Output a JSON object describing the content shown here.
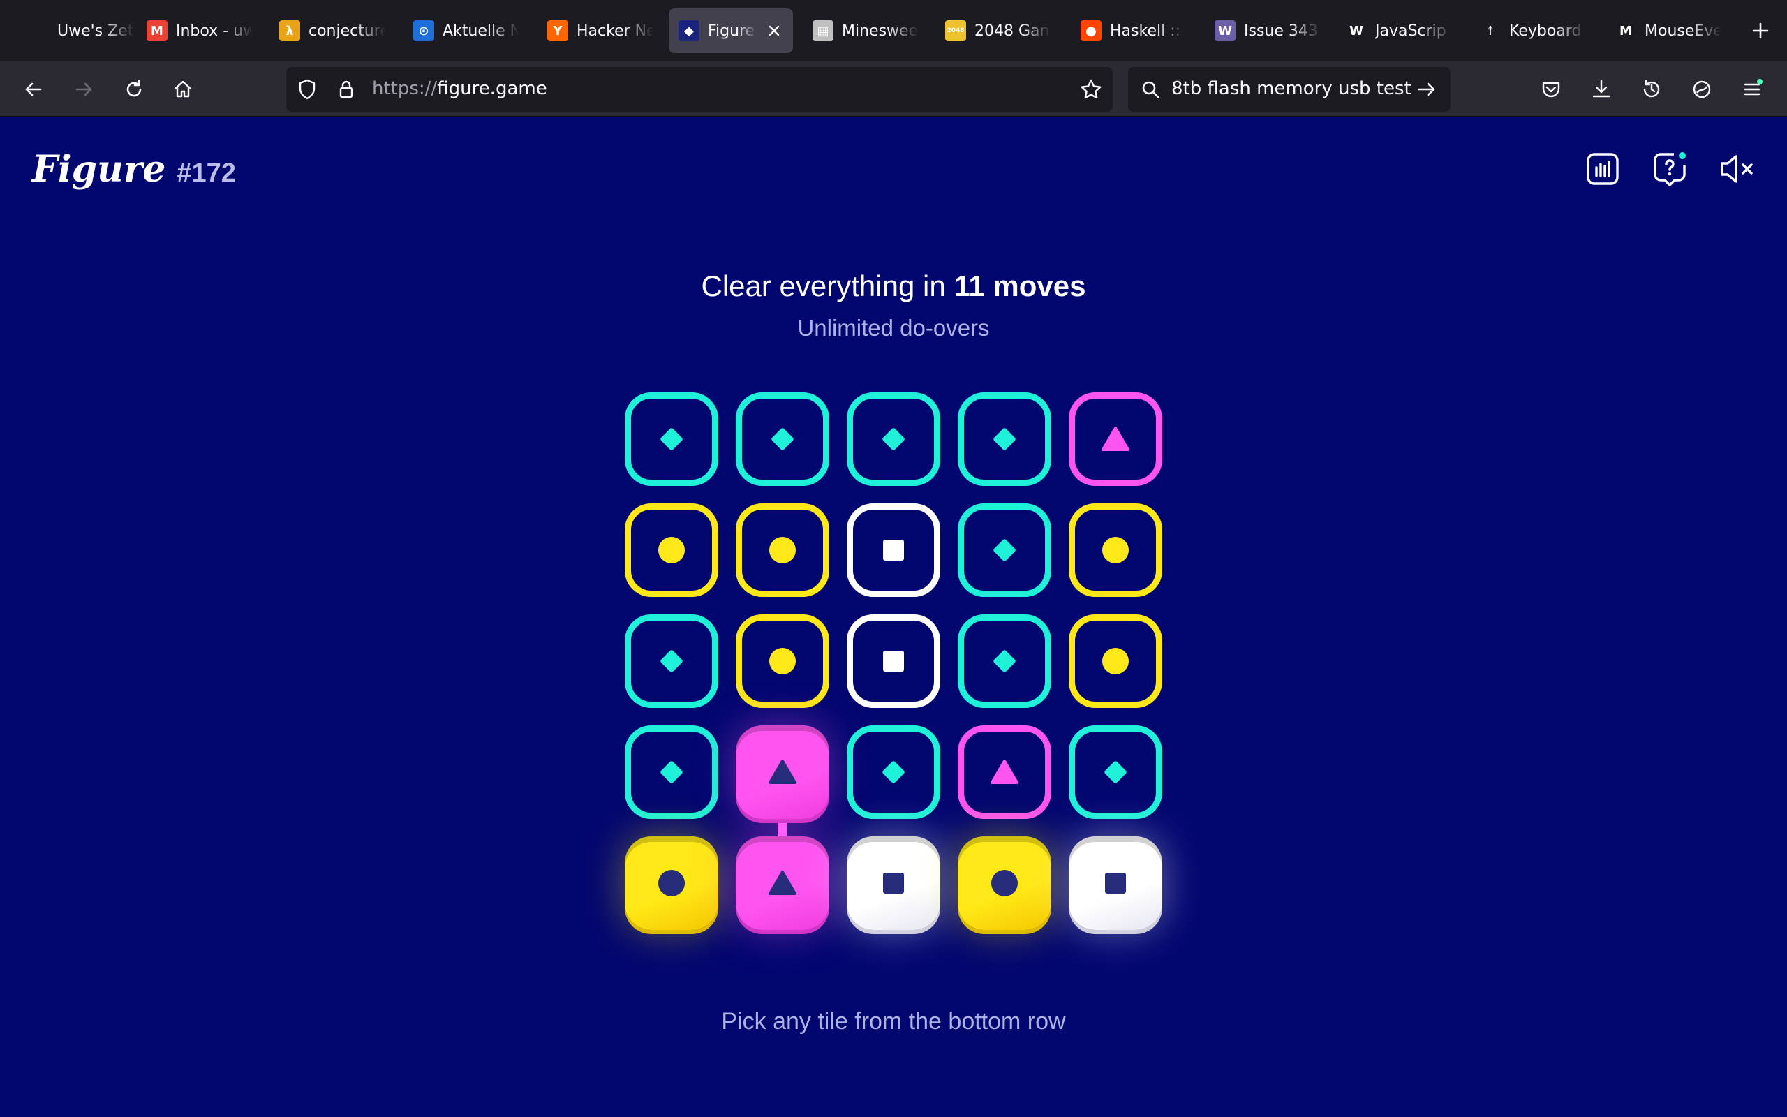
{
  "browser": {
    "tabs": [
      {
        "title": "Uwe's Zet",
        "favicon": "",
        "favicon_color": "#1c1b22",
        "active": false
      },
      {
        "title": "Inbox - uw",
        "favicon": "M",
        "favicon_color": "#ea4335",
        "active": false
      },
      {
        "title": "conjecture",
        "favicon": "λ",
        "favicon_color": "#e8a317",
        "active": false
      },
      {
        "title": "Aktuelle N",
        "favicon": "⊙",
        "favicon_color": "#1e6fd9",
        "active": false
      },
      {
        "title": "Hacker Ne",
        "favicon": "Y",
        "favicon_color": "#ff6600",
        "active": false
      },
      {
        "title": "Figure",
        "favicon": "◆",
        "favicon_color": "#1a237e",
        "active": true
      },
      {
        "title": "Mineswee",
        "favicon": "▦",
        "favicon_color": "#c0c0c0",
        "active": false
      },
      {
        "title": "2048 Gan",
        "favicon": "2048",
        "favicon_color": "#edc22e",
        "active": false
      },
      {
        "title": "Haskell ::",
        "favicon": "●",
        "favicon_color": "#ff4500",
        "active": false
      },
      {
        "title": "Issue 343",
        "favicon": "W",
        "favicon_color": "#6b5fa8",
        "active": false
      },
      {
        "title": "JavaScrip",
        "favicon": "W",
        "favicon_color": "#1c1b22",
        "active": false
      },
      {
        "title": "Keyboard",
        "favicon": "☨",
        "favicon_color": "#1c1b22",
        "active": false
      },
      {
        "title": "MouseEve",
        "favicon": "M",
        "favicon_color": "#1c1b22",
        "active": false
      }
    ],
    "url_scheme": "https://",
    "url_host": "figure.game",
    "search_query": "8tb flash memory usb test"
  },
  "game": {
    "logo": "Figure",
    "puzzle_number": "#172",
    "heading_prefix": "Clear everything in ",
    "heading_moves": "11 moves",
    "subheading": "Unlimited do-overs",
    "instruction": "Pick any tile from the bottom row",
    "colors": {
      "teal": "#1ff0d8",
      "yellow": "#ffe817",
      "white": "#ffffff",
      "pink": "#ff55f0",
      "background": "#02066f",
      "symbol_dark": "#272d7a"
    },
    "board": [
      [
        "teal",
        "teal",
        "teal",
        "teal",
        "pink"
      ],
      [
        "yellow",
        "yellow",
        "white",
        "teal",
        "yellow"
      ],
      [
        "teal",
        "yellow",
        "white",
        "teal",
        "yellow"
      ],
      [
        "teal",
        "pink",
        "teal",
        "pink",
        "teal"
      ],
      [
        "yellow",
        "pink",
        "white",
        "yellow",
        "white"
      ]
    ],
    "highlighted_tiles": [
      [
        4,
        0
      ],
      [
        4,
        1
      ],
      [
        4,
        2
      ],
      [
        4,
        3
      ],
      [
        4,
        4
      ],
      [
        3,
        1
      ]
    ],
    "shape_by_color": {
      "teal": "diamond",
      "yellow": "circle",
      "white": "square",
      "pink": "triangle"
    }
  }
}
